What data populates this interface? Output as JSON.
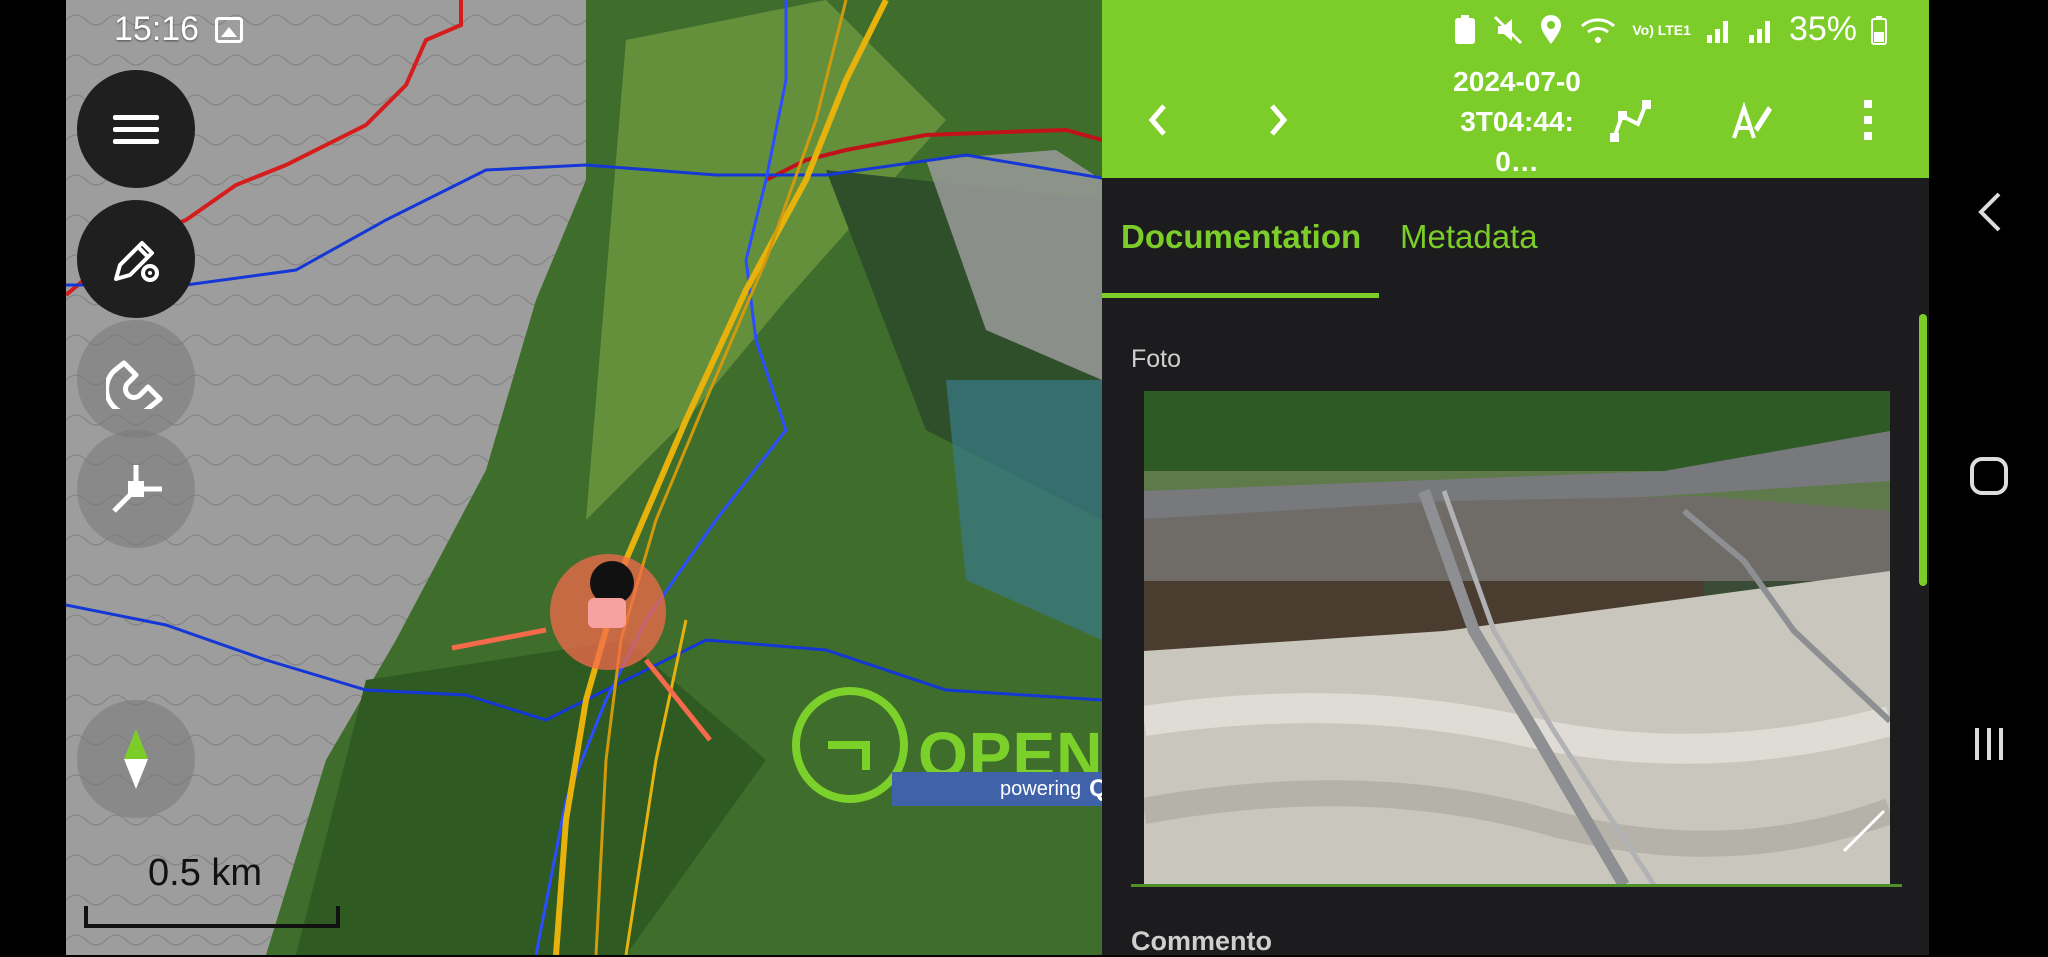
{
  "status_left": {
    "time": "15:16"
  },
  "status_right": {
    "network": "Vo) LTE1",
    "battery": "35%"
  },
  "map": {
    "scale_label": "0.5 km",
    "logo_text": "OPENG",
    "logo_tagline": "powering",
    "logo_tagline_suffix": "QF"
  },
  "topbar": {
    "title": "2024-07-03T04:44:0…"
  },
  "tabs": [
    {
      "label": "Documentation",
      "active": true
    },
    {
      "label": "Metadata",
      "active": false
    }
  ],
  "form": {
    "photo_label": "Foto",
    "comment_label": "Commento"
  },
  "colors": {
    "accent": "#7ccd2a",
    "panel_bg": "#1c1c1e",
    "fab_dark": "#1f1f1f",
    "track_red": "#d61d1d",
    "stream_blue": "#1437d6",
    "road_yellow": "#e7b20c",
    "marker": "#f46a4b"
  }
}
